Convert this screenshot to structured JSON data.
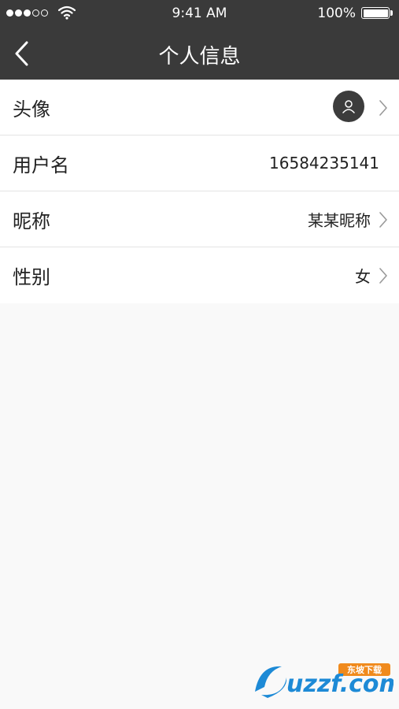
{
  "status_bar": {
    "time": "9:41 AM",
    "battery": "100%",
    "signal_icon": "signal-dots-icon",
    "wifi_icon": "wifi-icon",
    "battery_icon": "battery-icon"
  },
  "nav": {
    "title": "个人信息",
    "back_icon": "chevron-left-icon"
  },
  "rows": [
    {
      "label": "头像",
      "value": "",
      "icon": "avatar-user-icon"
    },
    {
      "label": "用户名",
      "value": "16584235141"
    },
    {
      "label": "昵称",
      "value": "某某昵称"
    },
    {
      "label": "性别",
      "value": "女"
    }
  ],
  "watermark": {
    "logo_text": "uzzf.com",
    "tagline": "东坡下载"
  },
  "colors": {
    "bar_background": "#3a3a3a",
    "page_background": "#f9f9f9",
    "row_background": "#ffffff",
    "divider": "#e4e4e4",
    "watermark_blue": "#1d8ad6",
    "watermark_orange": "#f08a1c"
  }
}
